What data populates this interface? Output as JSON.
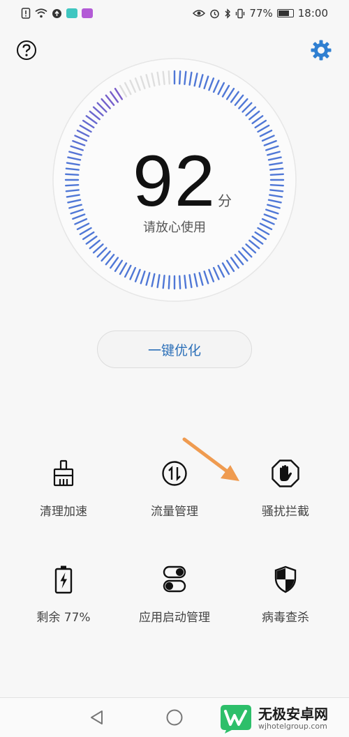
{
  "status_bar": {
    "icons": [
      "sim-alert-icon",
      "wifi-icon",
      "data-saver-icon",
      "app-badge-icon",
      "app-badge-icon",
      "eye-icon",
      "alarm-icon",
      "bluetooth-icon",
      "vibrate-icon",
      "battery-icon"
    ],
    "battery": "77%",
    "time": "18:00"
  },
  "header": {
    "help_icon": "question-circle-icon",
    "settings_icon": "gear-icon",
    "accent_color": "#2f7fd1"
  },
  "gauge": {
    "score": "92",
    "unit": "分",
    "caption": "请放心使用",
    "level": 0.92,
    "active_color": "#4f77d6",
    "gradient_end_color": "#7a5cc9",
    "inactive_color": "#dedede"
  },
  "optimize_button": {
    "label": "一键优化"
  },
  "tools": [
    {
      "label": "清理加速",
      "icon": "broom-icon"
    },
    {
      "label": "流量管理",
      "icon": "data-traffic-icon"
    },
    {
      "label": "骚扰拦截",
      "icon": "stop-hand-icon"
    },
    {
      "label": "剩余 77%",
      "icon": "battery-charging-icon"
    },
    {
      "label": "应用启动管理",
      "icon": "app-launch-toggle-icon"
    },
    {
      "label": "病毒查杀",
      "icon": "shield-icon"
    }
  ],
  "annotation": {
    "arrow_color": "#ef9b50"
  },
  "navbar": {
    "back_icon": "back-triangle-icon",
    "home_icon": "home-circle-icon"
  },
  "watermark": {
    "title": "无极安卓网",
    "url": "wjhotelgroup.com",
    "brand_color": "#2dbf6a"
  }
}
